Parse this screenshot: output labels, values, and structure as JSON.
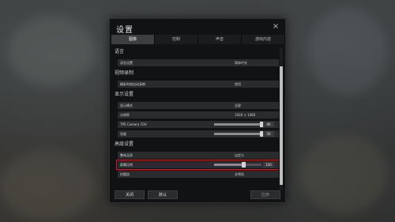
{
  "dialog": {
    "title": "设置",
    "close": "×"
  },
  "tabs": [
    {
      "label": "图像",
      "active": true
    },
    {
      "label": "控制",
      "active": false
    },
    {
      "label": "声音",
      "active": false
    },
    {
      "label": "游戏内容",
      "active": false
    }
  ],
  "sections": {
    "language": {
      "title": "语言",
      "rows": [
        {
          "label": "语言设置",
          "value": "简体中文"
        }
      ]
    },
    "recording": {
      "title": "视频录制",
      "rows": [
        {
          "label": "精彩时刻自动录制",
          "value": "禁用"
        }
      ]
    },
    "display": {
      "title": "显示设置",
      "rows": [
        {
          "label": "显示模式",
          "value": "全屏"
        },
        {
          "label": "分辨率",
          "value": "1920 × 1080"
        },
        {
          "label": "TPS Camera FOV",
          "slider": 1.0,
          "number": "90"
        },
        {
          "label": "亮度",
          "slider": 1.0,
          "number": "50"
        }
      ]
    },
    "advanced": {
      "title": "高级设置",
      "rows": [
        {
          "label": "整体品质",
          "value": "自定义"
        },
        {
          "label": "屏幕比例",
          "slider": 0.62,
          "number": "100"
        },
        {
          "label": "抗锯齿",
          "value": "非常低"
        }
      ]
    }
  },
  "footer": {
    "close_label": "关闭",
    "default_label": "默认",
    "apply_label": "应用"
  },
  "colors": {
    "highlight": "#c0283a",
    "panel": "#111213",
    "row": "#2a2b2c"
  }
}
